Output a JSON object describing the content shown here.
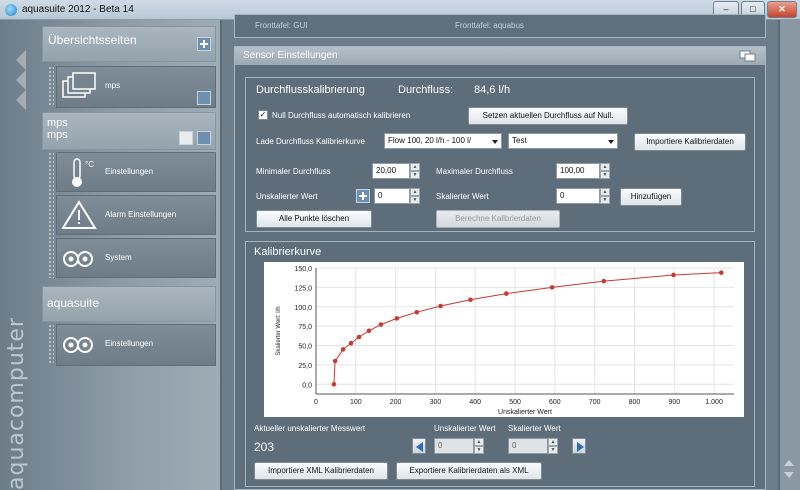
{
  "window": {
    "title": "aquasuite 2012 - Beta 14"
  },
  "sidebar": {
    "brand": "aquacomputer",
    "overview": {
      "title": "Übersichtsseiten",
      "tiles": [
        {
          "label": "mps",
          "icon": "windows-stack-icon"
        }
      ]
    },
    "device": {
      "title": "mps",
      "subtitle": "mps",
      "tiles": [
        {
          "label": "Einstellungen",
          "icon": "thermometer-icon"
        },
        {
          "label": "Alarm Einstellungen",
          "icon": "warning-triangle-icon"
        },
        {
          "label": "System",
          "icon": "gears-icon"
        }
      ]
    },
    "app": {
      "title": "aquasuite",
      "tiles": [
        {
          "label": "Einstellungen",
          "icon": "gears-icon"
        }
      ]
    }
  },
  "top_partial": {
    "option1": "Fronttafel: GUI",
    "option2": "Fronttafel: aquabus"
  },
  "sensor": {
    "title": "Sensor Einstellungen",
    "calib": {
      "heading": "Durchflusskalibrierung",
      "flow_label": "Durchfluss:",
      "flow_value": "84,6 l/h",
      "auto_zero_label": "Null Durchfluss automatisch kalibrieren",
      "auto_zero_checked": true,
      "set_zero_button": "Setzen aktuellen Durchfluss auf Null.",
      "load_curve_label": "Lade Durchfluss Kalibrierkurve",
      "curve_select": "Flow 100, 20 l/h - 100 l/",
      "name_select": "Test",
      "import_button": "Importiere Kalibrierdaten",
      "min_label": "Minimaler Durchfluss",
      "min_value": "20,00",
      "max_label": "Maximaler Durchfluss",
      "max_value": "100,00",
      "unscaled_label": "Unskalierter Wert",
      "unscaled_value": "0",
      "scaled_label": "Skalierter Wert",
      "scaled_value": "0",
      "add_button": "Hinzufügen",
      "delete_all_button": "Alle Punkte löschen",
      "compute_button": "Berechne Kalibrierdaten"
    },
    "curve": {
      "heading": "Kalibrierkurve",
      "current_label": "Aktueller unskalierter Messwert",
      "current_value": "203",
      "unscaled_label": "Unskalierter Wert",
      "scaled_label": "Skalierter Wert",
      "unscaled_value": "0",
      "scaled_value": "0",
      "import_xml_button": "Importiere XML Kalibrierdaten",
      "export_xml_button": "Exportiere Kalibrierdaten als XML"
    }
  },
  "chart_data": {
    "type": "line",
    "xlabel": "Unskalierter Wert",
    "ylabel": "Skalierter Wert: l/h",
    "xlim": [
      0,
      1050
    ],
    "ylim": [
      -12.5,
      150
    ],
    "x_ticks": [
      "0",
      "100",
      "200",
      "300",
      "400",
      "500",
      "600",
      "700",
      "800",
      "900",
      "1.000"
    ],
    "x_tick_values": [
      0,
      100,
      200,
      300,
      400,
      500,
      600,
      700,
      800,
      900,
      1000
    ],
    "y_ticks": [
      "150,0",
      "125,0",
      "100,0",
      "75,0",
      "50,0",
      "25,0",
      "0,0"
    ],
    "y_tick_values": [
      150,
      125,
      100,
      75,
      50,
      25,
      0
    ],
    "series_color": "#c83a32",
    "x": [
      45,
      48,
      68,
      88,
      108,
      133,
      163,
      203,
      253,
      313,
      388,
      478,
      593,
      723,
      898,
      1018
    ],
    "values": [
      0,
      30,
      45,
      53,
      61,
      69,
      77,
      85,
      93,
      101,
      109,
      117,
      125,
      133,
      141,
      144
    ]
  }
}
